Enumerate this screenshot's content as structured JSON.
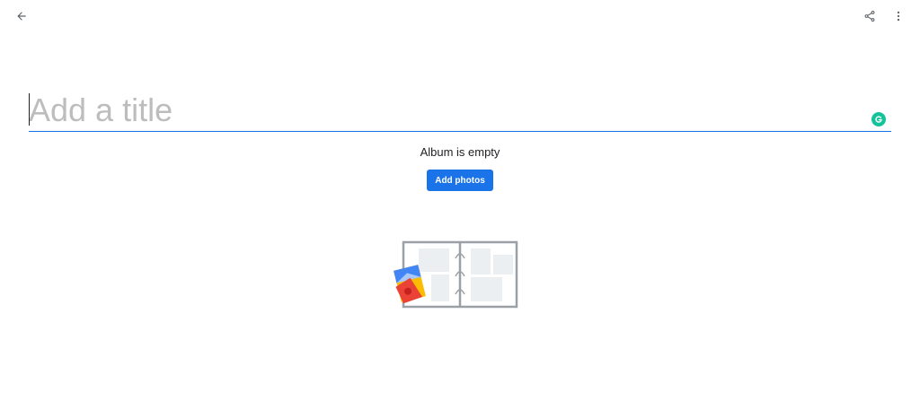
{
  "toolbar": {
    "back_icon": "arrow-back-icon",
    "share_icon": "share-icon",
    "more_icon": "more-vert-icon"
  },
  "title": {
    "placeholder": "Add a title",
    "value": "",
    "underline_color": "#1a73e8"
  },
  "extension": {
    "icon": "grammarly-icon",
    "color": "#15c39a"
  },
  "album": {
    "empty_message": "Album is empty",
    "add_photos_label": "Add photos",
    "button_color": "#1a73e8",
    "illustration": "empty-album-illustration"
  }
}
